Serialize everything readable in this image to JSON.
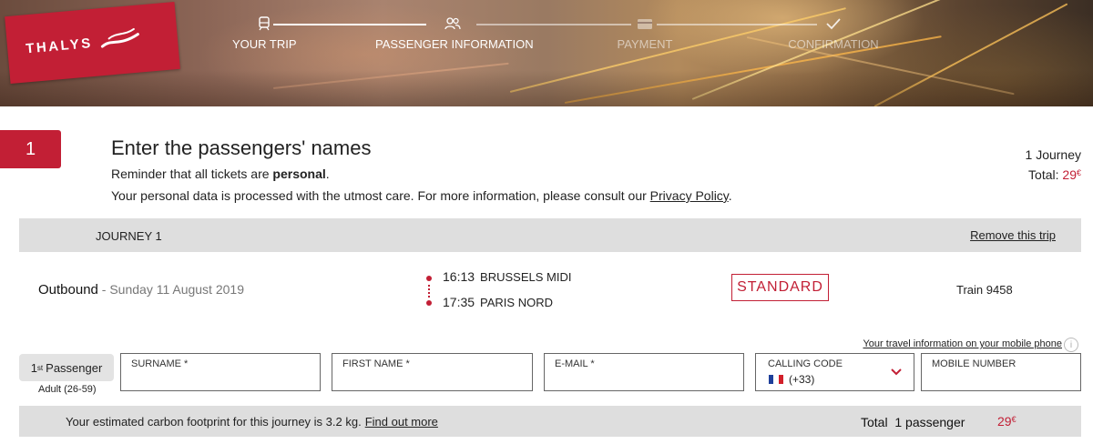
{
  "brand": {
    "name": "THALYS",
    "color": "#c21f35"
  },
  "steps": [
    {
      "label": "YOUR TRIP",
      "icon": "train-icon",
      "state": "done"
    },
    {
      "label": "PASSENGER INFORMATION",
      "icon": "passengers-icon",
      "state": "active"
    },
    {
      "label": "PAYMENT",
      "icon": "card-icon",
      "state": "upcoming"
    },
    {
      "label": "CONFIRMATION",
      "icon": "check-icon",
      "state": "upcoming"
    }
  ],
  "section": {
    "number": "1",
    "title": "Enter the passengers' names",
    "reminder_prefix": "Reminder that all tickets are ",
    "reminder_bold": "personal",
    "reminder_suffix": ".",
    "privacy_text": "Your personal data is processed with the utmost care. For more information, please consult our ",
    "privacy_link": "Privacy Policy",
    "privacy_suffix": "."
  },
  "summary": {
    "journeys": "1 Journey",
    "total_label": "Total: ",
    "total_amount": "29",
    "currency": "€"
  },
  "journey": {
    "title": "JOURNEY 1",
    "remove_label": "Remove this trip",
    "direction": "Outbound",
    "date": " - Sunday 11 August 2019",
    "departure": {
      "time": "16:13",
      "station": "BRUSSELS MIDI"
    },
    "arrival": {
      "time": "17:35",
      "station": "PARIS NORD"
    },
    "travel_class": "STANDARD",
    "train": "Train 9458"
  },
  "passenger": {
    "ordinal_num": "1",
    "ordinal_suffix": "st",
    "label": "Passenger",
    "type": "Adult (26-59)",
    "mobile_info_link": "Your travel information on your mobile phone",
    "fields": {
      "surname": {
        "label": "SURNAME *",
        "value": ""
      },
      "first_name": {
        "label": "FIRST NAME *",
        "value": ""
      },
      "email": {
        "label": "E-MAIL *",
        "value": ""
      },
      "calling_code": {
        "label": "CALLING CODE",
        "value": "(+33)",
        "flag": "france-flag"
      },
      "mobile": {
        "label": "MOBILE NUMBER",
        "value": ""
      }
    }
  },
  "footer": {
    "carbon_text": "Your estimated carbon footprint for this journey is 3.2 kg.",
    "carbon_link": "Find out more",
    "total_label": "Total  1 passenger",
    "total_amount": "29",
    "currency": "€"
  }
}
